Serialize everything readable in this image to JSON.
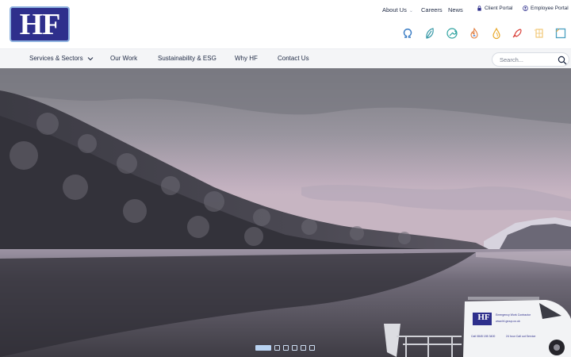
{
  "brand": {
    "logo_text": "HF"
  },
  "top_links": {
    "about": "About Us",
    "careers": "Careers",
    "news": "News",
    "client_portal": "Client Portal",
    "employee_portal": "Employee Portal"
  },
  "sector_icons": [
    "omega-icon",
    "leaf-icon",
    "wrench-icon",
    "flame-icon",
    "drop-icon",
    "rocket-icon",
    "solar-panel-icon",
    "square-icon"
  ],
  "nav": {
    "services": "Services & Sectors",
    "our_work": "Our Work",
    "sustainability": "Sustainability & ESG",
    "why_hf": "Why HF",
    "contact": "Contact Us"
  },
  "search": {
    "placeholder": "Search..."
  },
  "hero": {
    "van_brand": "HF",
    "van_line1": "Emergency Work Contractor",
    "van_line2": "www.hf-group.co.uk",
    "van_line3": "Call 0845 155 3400",
    "van_line4": "24 hour Call out Service"
  },
  "slider": {
    "slide_count": 6,
    "active_index": 0
  },
  "colors": {
    "brand": "#2e2f8c",
    "accent": "#8fb3e0",
    "text": "#1f2a44"
  }
}
